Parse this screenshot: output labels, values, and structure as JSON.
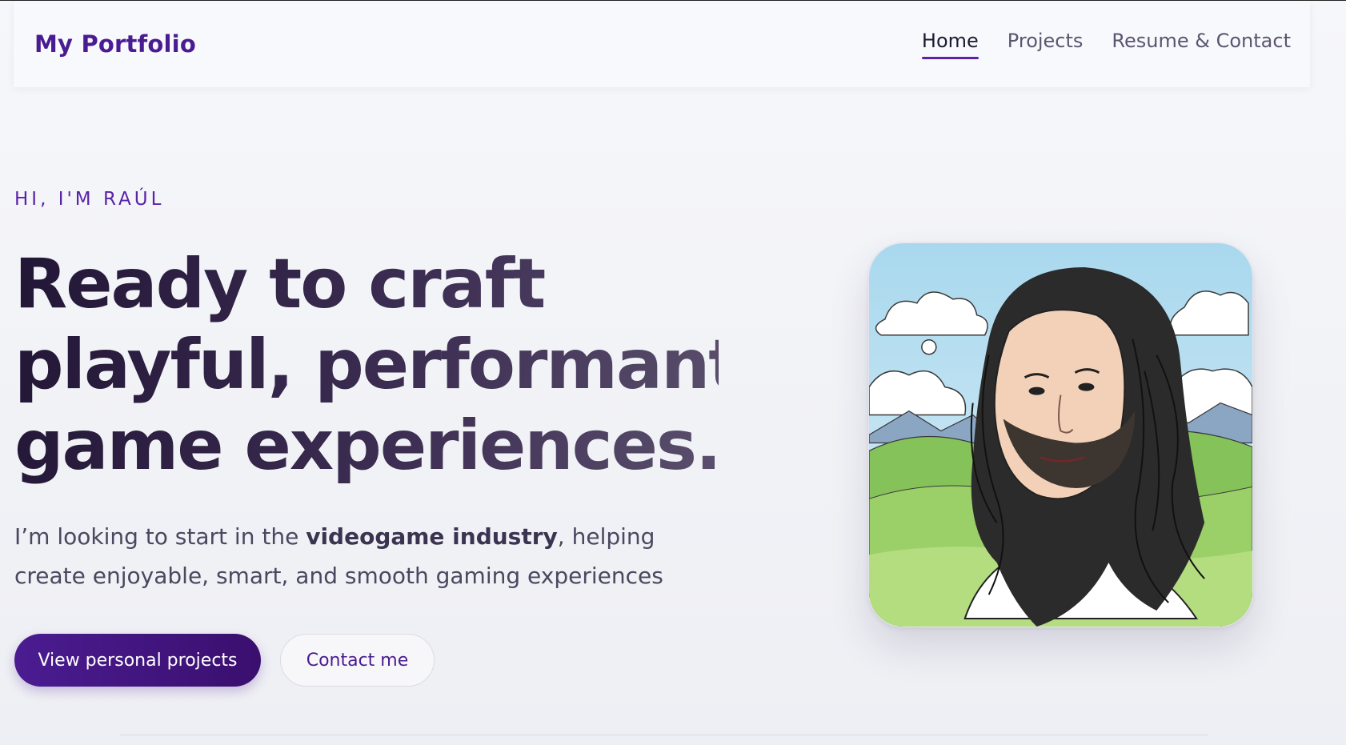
{
  "header": {
    "brand": "My Portfolio",
    "nav": [
      {
        "label": "Home",
        "active": true
      },
      {
        "label": "Projects",
        "active": false
      },
      {
        "label": "Resume & Contact",
        "active": false
      }
    ]
  },
  "hero": {
    "eyebrow": "HI, I'M RAÚL",
    "headline_lines": [
      "Ready to craft",
      "playful, performant",
      "game experiences."
    ],
    "subtitle_before": "I’m looking to start in the ",
    "subtitle_bold": "videogame industry",
    "subtitle_after": ", helping create enjoyable, smart, and smooth gaming experiences",
    "primary_button": "View personal projects",
    "secondary_button": "Contact me"
  },
  "colors": {
    "accent": "#4a1c91",
    "headline": "#221636",
    "text": "#4b4760"
  },
  "portrait": {
    "icon": "illustrated-portrait"
  }
}
